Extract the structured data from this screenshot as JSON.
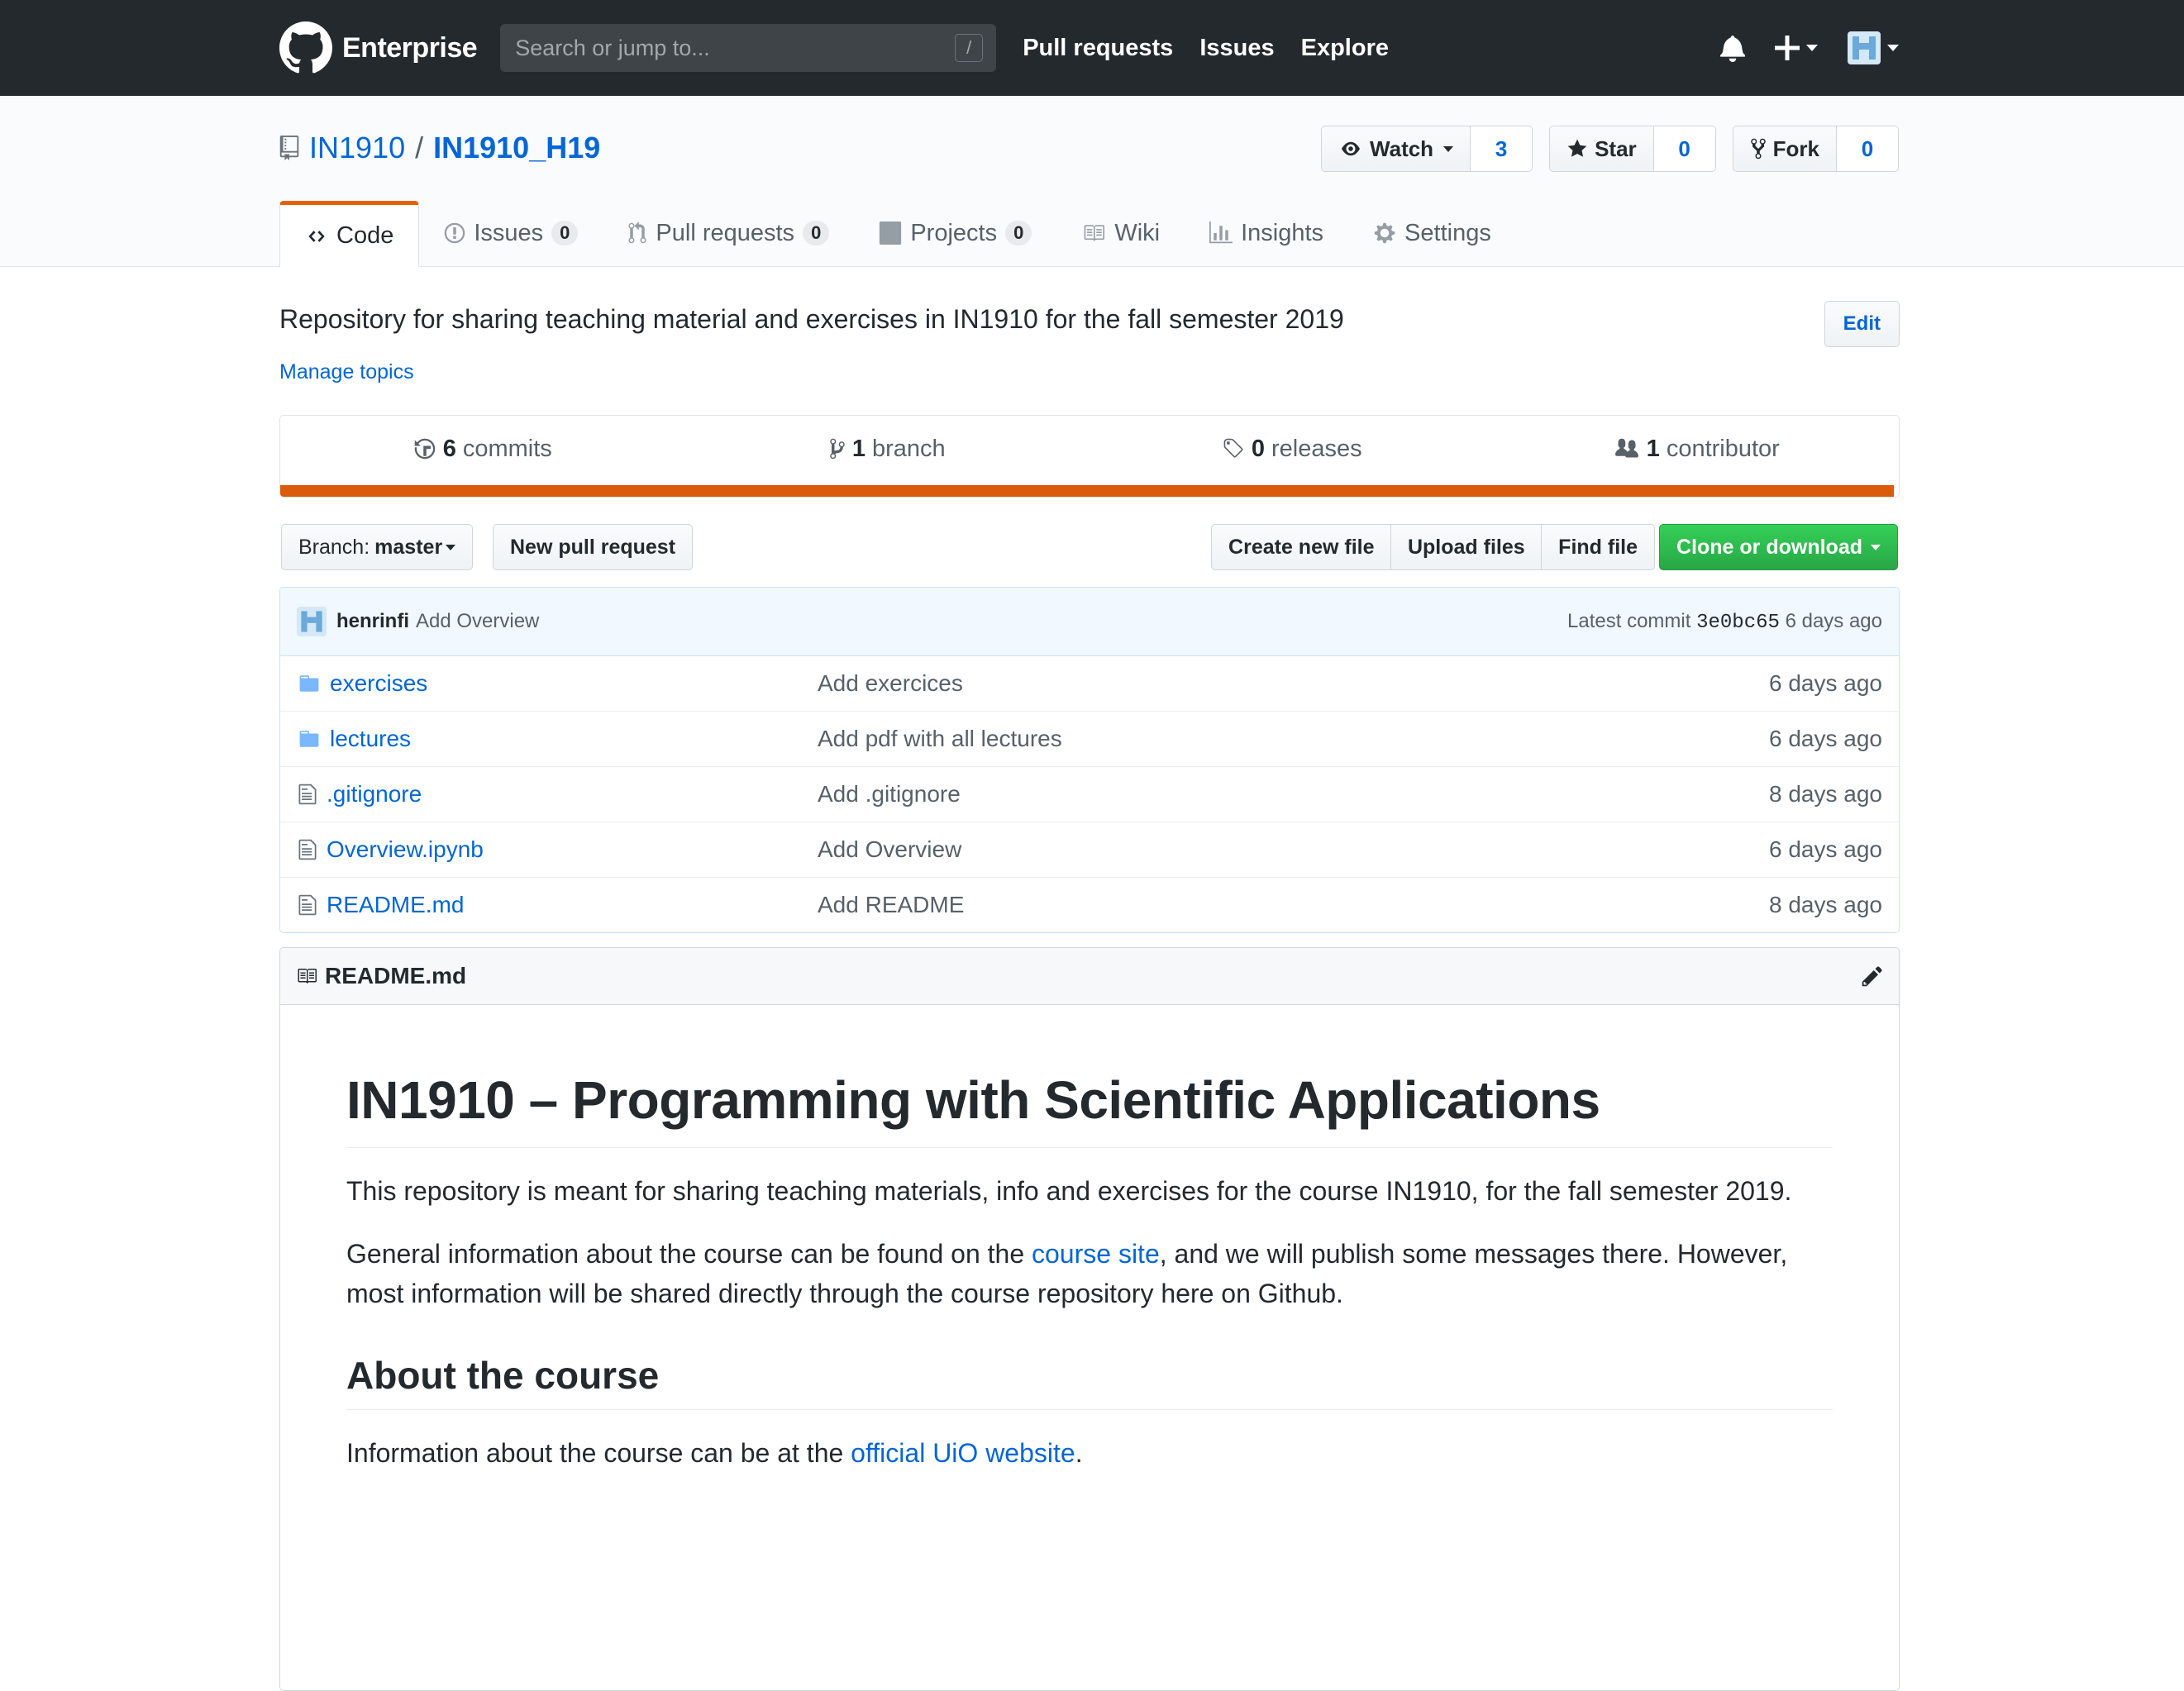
{
  "header": {
    "brand": "Enterprise",
    "search_placeholder": "Search or jump to...",
    "search_shortcut": "/",
    "nav": [
      "Pull requests",
      "Issues",
      "Explore"
    ]
  },
  "repo": {
    "owner": "IN1910",
    "separator": "/",
    "name": "IN1910_H19",
    "watch_label": "Watch",
    "watch_count": "3",
    "star_label": "Star",
    "star_count": "0",
    "fork_label": "Fork",
    "fork_count": "0",
    "tabs": [
      {
        "label": "Code",
        "count": null
      },
      {
        "label": "Issues",
        "count": "0"
      },
      {
        "label": "Pull requests",
        "count": "0"
      },
      {
        "label": "Projects",
        "count": "0"
      },
      {
        "label": "Wiki",
        "count": null
      },
      {
        "label": "Insights",
        "count": null
      },
      {
        "label": "Settings",
        "count": null
      }
    ],
    "description": "Repository for sharing teaching material and exercises in IN1910 for the fall semester 2019",
    "edit_label": "Edit",
    "manage_topics": "Manage topics",
    "summary": {
      "commits_num": "6",
      "commits_label": "commits",
      "branch_num": "1",
      "branch_label": "branch",
      "releases_num": "0",
      "releases_label": "releases",
      "contributors_num": "1",
      "contributors_label": "contributor"
    },
    "language_color": "#da5b0b"
  },
  "filebar": {
    "branch_prefix": "Branch:",
    "branch": "master",
    "new_pr": "New pull request",
    "create_file": "Create new file",
    "upload_files": "Upload files",
    "find_file": "Find file",
    "clone": "Clone or download"
  },
  "commit": {
    "author": "henrinfi",
    "message": "Add Overview",
    "latest_prefix": "Latest commit",
    "sha": "3e0bc65",
    "age": "6 days ago"
  },
  "files": [
    {
      "type": "dir",
      "name": "exercises",
      "message": "Add exercices",
      "age": "6 days ago"
    },
    {
      "type": "dir",
      "name": "lectures",
      "message": "Add pdf with all lectures",
      "age": "6 days ago"
    },
    {
      "type": "file",
      "name": ".gitignore",
      "message": "Add .gitignore",
      "age": "8 days ago"
    },
    {
      "type": "file",
      "name": "Overview.ipynb",
      "message": "Add Overview",
      "age": "6 days ago"
    },
    {
      "type": "file",
      "name": "README.md",
      "message": "Add README",
      "age": "8 days ago"
    }
  ],
  "readme": {
    "filename": "README.md",
    "h1": "IN1910 – Programming with Scientific Applications",
    "p1": "This repository is meant for sharing teaching materials, info and exercises for the course IN1910, for the fall semester 2019.",
    "p2_before": "General information about the course can be found on the ",
    "p2_link": "course site",
    "p2_after": ", and we will publish some messages there. However, most information will be shared directly through the course repository here on Github.",
    "h2": "About the course",
    "p3_before": "Information about the course can be at the ",
    "p3_link": "official UiO website",
    "p3_after": "."
  }
}
